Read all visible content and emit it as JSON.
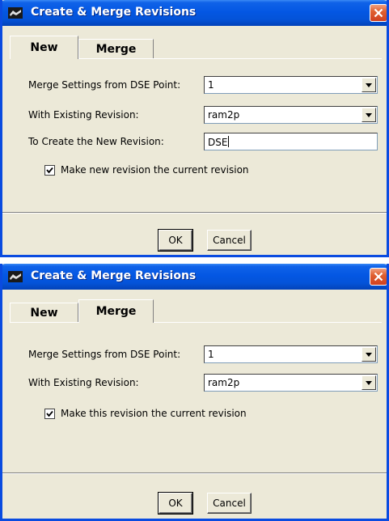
{
  "dialogs": [
    {
      "title": "Create & Merge Revisions",
      "tabs": [
        {
          "label": "New"
        },
        {
          "label": "Merge"
        }
      ],
      "active_tab": "New",
      "fields": {
        "dse_point": {
          "label": "Merge Settings from DSE Point:",
          "value": "1"
        },
        "existing_revision": {
          "label": "With Existing Revision:",
          "value": "ram2p"
        },
        "new_revision": {
          "label": "To Create the New Revision:",
          "value": "DSE"
        }
      },
      "checkbox": {
        "label": "Make new revision the current revision",
        "checked": true
      },
      "ok_label": "OK",
      "cancel_label": "Cancel"
    },
    {
      "title": "Create & Merge Revisions",
      "tabs": [
        {
          "label": "New"
        },
        {
          "label": "Merge"
        }
      ],
      "active_tab": "Merge",
      "fields": {
        "dse_point": {
          "label": "Merge Settings from DSE Point:",
          "value": "1"
        },
        "existing_revision": {
          "label": "With Existing Revision:",
          "value": "ram2p"
        }
      },
      "checkbox": {
        "label": "Make this revision the current revision",
        "checked": true
      },
      "ok_label": "OK",
      "cancel_label": "Cancel"
    }
  ],
  "colors": {
    "titlebar": "#0457e3",
    "window_bg": "#ece9d8",
    "close_button": "#e06030"
  },
  "icons": {
    "app": "app-icon",
    "close": "close-icon",
    "dropdown": "chevron-down-icon",
    "check": "checkmark-icon"
  }
}
